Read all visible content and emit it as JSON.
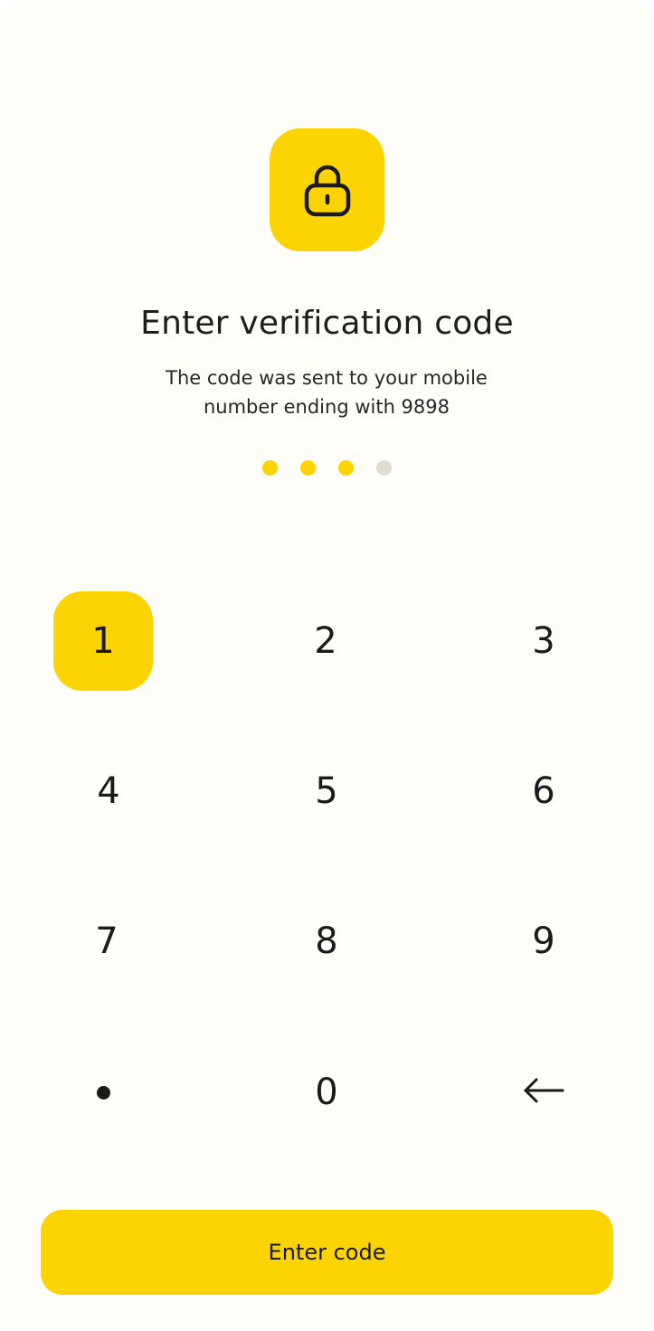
{
  "header": {
    "icon": "lock-icon",
    "title": "Enter verification code",
    "subtitle": "The code was sent to your mobile number ending with 9898"
  },
  "code_entry": {
    "total_digits": 4,
    "entered_digits": 3
  },
  "keypad": {
    "keys": [
      "1",
      "2",
      "3",
      "4",
      "5",
      "6",
      "7",
      "8",
      "9",
      "0"
    ],
    "decimal_icon": "dot-icon",
    "backspace_icon": "backspace-arrow-icon",
    "pressed_key": "1"
  },
  "actions": {
    "enter_label": "Enter code"
  },
  "colors": {
    "accent": "#fcd404",
    "background": "#fffdf7",
    "inactive_dot": "#dedbd0",
    "text": "#1a1a1a"
  }
}
